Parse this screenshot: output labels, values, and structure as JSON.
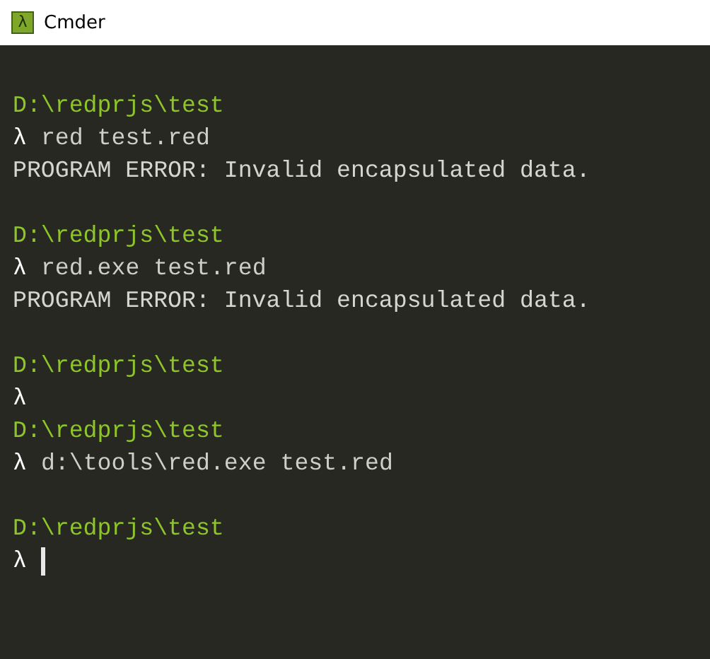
{
  "window": {
    "title": "Cmder",
    "icon_text": "λ"
  },
  "lines": [
    {
      "kind": "blank"
    },
    {
      "kind": "path",
      "text": "D:\\redprjs\\test"
    },
    {
      "kind": "command",
      "prompt": "λ",
      "text": "red test.red"
    },
    {
      "kind": "output",
      "text": "PROGRAM ERROR: Invalid encapsulated data."
    },
    {
      "kind": "blank"
    },
    {
      "kind": "path",
      "text": "D:\\redprjs\\test"
    },
    {
      "kind": "command",
      "prompt": "λ",
      "text": "red.exe test.red"
    },
    {
      "kind": "output",
      "text": "PROGRAM ERROR: Invalid encapsulated data."
    },
    {
      "kind": "blank"
    },
    {
      "kind": "path",
      "text": "D:\\redprjs\\test"
    },
    {
      "kind": "command",
      "prompt": "λ"
    },
    {
      "kind": "path",
      "text": "D:\\redprjs\\test"
    },
    {
      "kind": "command",
      "prompt": "λ",
      "text": "d:\\tools\\red.exe test.red"
    },
    {
      "kind": "blank"
    },
    {
      "kind": "path",
      "text": "D:\\redprjs\\test"
    },
    {
      "kind": "command",
      "prompt": "λ",
      "cursor": true
    }
  ]
}
